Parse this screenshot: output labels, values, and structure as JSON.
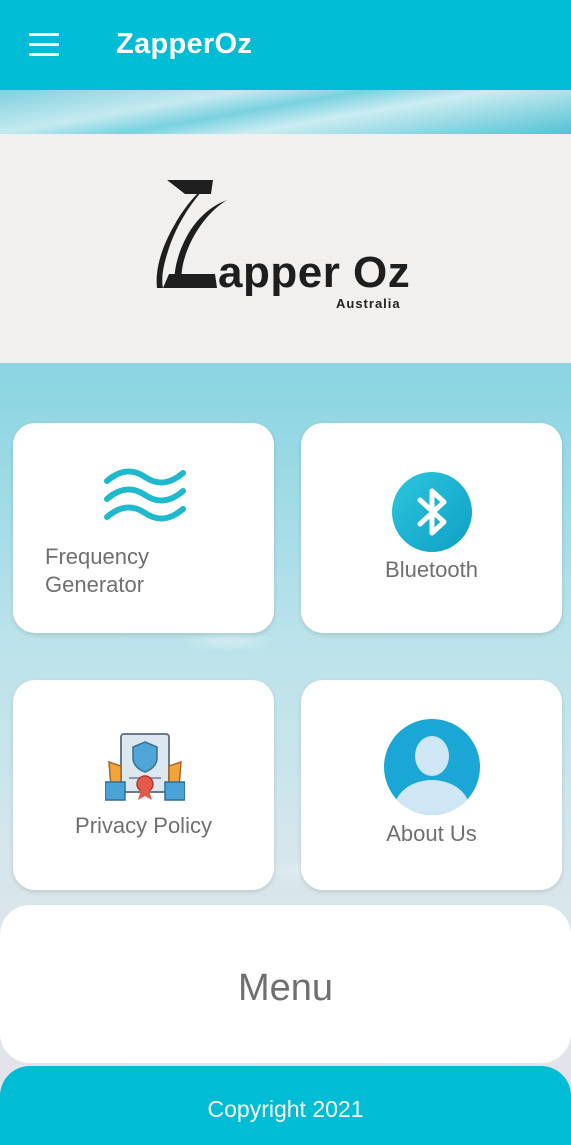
{
  "app": {
    "title": "ZapperOz"
  },
  "logo": {
    "name": "Zapper Oz",
    "sub": "Australia",
    "text_main": "apper Oz"
  },
  "tiles": [
    {
      "label_line1": "Frequency",
      "label_line2": "Generator",
      "icon": "waves-icon"
    },
    {
      "label": "Bluetooth",
      "icon": "bluetooth-icon"
    },
    {
      "label": "Privacy Policy",
      "icon": "certificate-icon"
    },
    {
      "label": "About Us",
      "icon": "user-avatar-icon"
    }
  ],
  "menu": {
    "label": "Menu"
  },
  "footer": {
    "text": "Copyright 2021"
  },
  "colors": {
    "primary": "#00bcd4",
    "label_gray": "#6f6f6f",
    "logo_bg": "#f1f0ef"
  }
}
